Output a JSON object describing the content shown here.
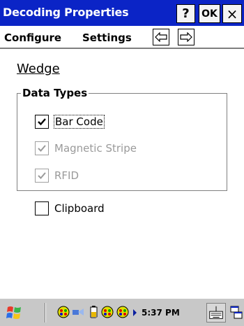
{
  "window": {
    "title": "Decoding Properties",
    "help_label": "?",
    "ok_label": "OK",
    "close_label": "×"
  },
  "menu": {
    "items": [
      "Configure",
      "Settings"
    ]
  },
  "page": {
    "title": "Wedge"
  },
  "data_types": {
    "group_label": "Data Types",
    "options": [
      {
        "label": "Bar Code",
        "checked": true,
        "enabled": true
      },
      {
        "label": "Magnetic Stripe",
        "checked": true,
        "enabled": false
      },
      {
        "label": "RFID",
        "checked": true,
        "enabled": false
      }
    ]
  },
  "clipboard": {
    "label": "Clipboard",
    "checked": false
  },
  "taskbar": {
    "clock": "5:37 PM"
  },
  "colors": {
    "titlebar": "#0b24c6",
    "taskbar": "#c8c8c8",
    "disabled_text": "#9a9a9a"
  }
}
